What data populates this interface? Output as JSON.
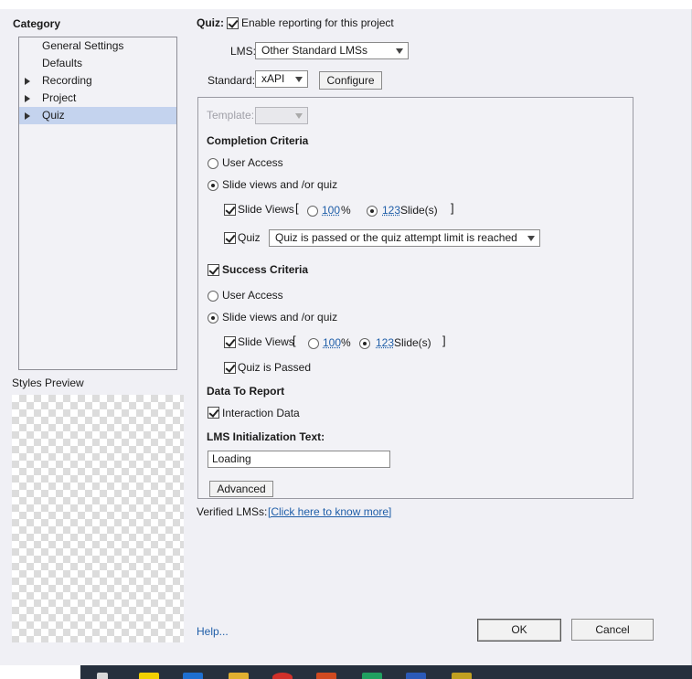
{
  "category": {
    "heading": "Category",
    "items": [
      {
        "label": "General Settings",
        "has_arrow": false,
        "selected": false
      },
      {
        "label": "Defaults",
        "has_arrow": false,
        "selected": false
      },
      {
        "label": "Recording",
        "has_arrow": true,
        "selected": false
      },
      {
        "label": "Project",
        "has_arrow": true,
        "selected": false
      },
      {
        "label": "Quiz",
        "has_arrow": true,
        "selected": true
      }
    ]
  },
  "styles_preview": {
    "label": "Styles Preview"
  },
  "quiz": {
    "label": "Quiz:",
    "enable_reporting": {
      "label": "Enable reporting for this project",
      "checked": true
    }
  },
  "lms": {
    "label": "LMS:",
    "value": "Other Standard LMSs"
  },
  "standard": {
    "label": "Standard:",
    "value": "xAPI",
    "configure_button": "Configure"
  },
  "template": {
    "label": "Template:",
    "value": "",
    "disabled": true
  },
  "completion": {
    "heading": "Completion Criteria",
    "user_access": {
      "label": "User Access",
      "selected": false
    },
    "slide_views_quiz": {
      "label": "Slide views and /or quiz",
      "selected": true
    },
    "slide_views": {
      "label": "Slide Views",
      "checked": true,
      "open_bracket": "[",
      "percent_value": "100",
      "percent_unit": "%",
      "percent_selected": false,
      "slides_value": "123",
      "slides_unit": "Slide(s)",
      "slides_selected": true,
      "close_bracket": "]"
    },
    "quiz": {
      "label": "Quiz",
      "checked": true,
      "value": "Quiz is passed or the quiz attempt limit is reached"
    }
  },
  "success": {
    "heading": "Success Criteria",
    "checked": true,
    "user_access": {
      "label": "User Access",
      "selected": false
    },
    "slide_views_quiz": {
      "label": "Slide views and /or quiz",
      "selected": true
    },
    "slide_views": {
      "label": "Slide Views",
      "checked": true,
      "open_bracket": "[",
      "percent_value": "100",
      "percent_unit": "%",
      "percent_selected": false,
      "slides_value": "123",
      "slides_unit": "Slide(s)",
      "slides_selected": true,
      "close_bracket": "]"
    },
    "quiz_passed": {
      "label": "Quiz is Passed",
      "checked": true
    }
  },
  "data_to_report": {
    "heading": "Data To Report",
    "interaction_data": {
      "label": "Interaction Data",
      "checked": true
    }
  },
  "lms_init": {
    "label": "LMS Initialization Text:",
    "value": "Loading"
  },
  "advanced_button": "Advanced",
  "verified": {
    "label": "Verified LMSs:",
    "link": "[Click here to know more]"
  },
  "footer": {
    "help": "Help...",
    "ok": "OK",
    "cancel": "Cancel"
  },
  "taskbar": {
    "icons": [
      {
        "name": "tb-icon-1",
        "color": "#f1d000"
      },
      {
        "name": "tb-icon-2",
        "color": "#1e6fd0"
      },
      {
        "name": "tb-icon-3",
        "color": "#e0b030"
      },
      {
        "name": "tb-icon-4",
        "color": "#d0302a"
      },
      {
        "name": "tb-icon-5",
        "color": "#d04a20"
      },
      {
        "name": "tb-icon-6",
        "color": "#20a060"
      },
      {
        "name": "tb-icon-7",
        "color": "#2b5ab8"
      },
      {
        "name": "tb-icon-8",
        "color": "#c0a020"
      }
    ]
  }
}
